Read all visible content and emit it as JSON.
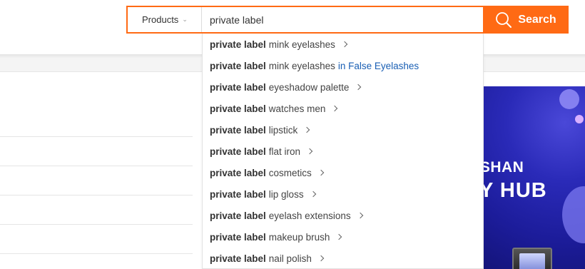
{
  "search": {
    "category_label": "Products",
    "query": "private label",
    "button_label": "Search"
  },
  "suggestions": [
    {
      "bold": "private label",
      "rest": "mink eyelashes",
      "category": ""
    },
    {
      "bold": "private label",
      "rest": "mink eyelashes",
      "category": "in False Eyelashes"
    },
    {
      "bold": "private label",
      "rest": "eyeshadow palette",
      "category": ""
    },
    {
      "bold": "private label",
      "rest": "watches men",
      "category": ""
    },
    {
      "bold": "private label",
      "rest": "lipstick",
      "category": ""
    },
    {
      "bold": "private label",
      "rest": "flat iron",
      "category": ""
    },
    {
      "bold": "private label",
      "rest": "cosmetics",
      "category": ""
    },
    {
      "bold": "private label",
      "rest": "lip gloss",
      "category": ""
    },
    {
      "bold": "private label",
      "rest": "eyelash extensions",
      "category": ""
    },
    {
      "bold": "private label",
      "rest": "makeup brush",
      "category": ""
    },
    {
      "bold": "private label",
      "rest": "nail polish",
      "category": ""
    }
  ],
  "banner": {
    "line1": "GSHAN",
    "line2": "Y HUB"
  },
  "colors": {
    "accent": "#ff6a14",
    "link": "#1a5fb4",
    "banner_bg": "#2a2ab8"
  },
  "icons": {
    "search": "magnifier-icon",
    "category_chevron": "chevron-down-icon",
    "suggestion_arrow": "chevron-right-icon"
  }
}
